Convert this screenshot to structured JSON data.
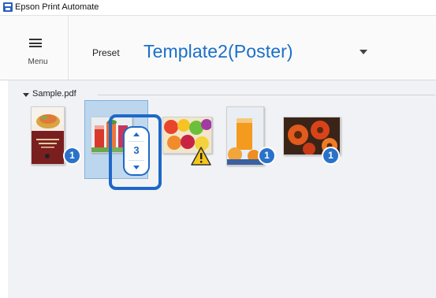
{
  "window": {
    "title": "Epson Print Automate",
    "icon": "epson-app-icon"
  },
  "header": {
    "menu_label": "Menu",
    "preset_label": "Preset",
    "preset_value": "Template2(Poster)"
  },
  "colors": {
    "accent": "#1a6fc9",
    "badge": "#2a72c9",
    "selection": "#bcd6ee",
    "warning": "#f5c518"
  },
  "group": {
    "name": "Sample.pdf",
    "expanded": true
  },
  "thumbnails": [
    {
      "copies": "1",
      "warning": false,
      "selected": false
    },
    {
      "copies": "3",
      "warning": false,
      "selected": true
    },
    {
      "copies": "",
      "warning": true,
      "selected": false
    },
    {
      "copies": "1",
      "warning": false,
      "selected": false
    },
    {
      "copies": "1",
      "warning": false,
      "selected": false
    }
  ],
  "stepper": {
    "value": "3",
    "up_icon": "chevron-up-icon",
    "down_icon": "chevron-down-icon"
  }
}
